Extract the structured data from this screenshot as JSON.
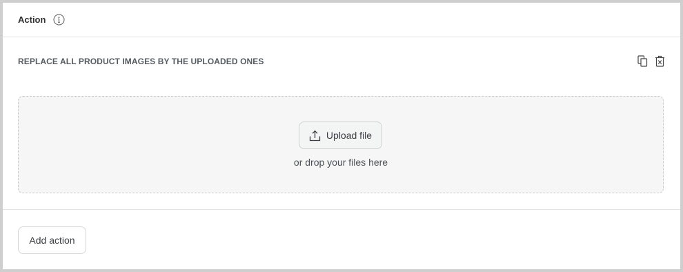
{
  "header": {
    "title": "Action",
    "info_icon": "info-icon"
  },
  "action": {
    "title": "REPLACE ALL PRODUCT IMAGES BY THE UPLOADED ONES",
    "icons": [
      "duplicate-icon",
      "delete-icon"
    ]
  },
  "dropzone": {
    "upload_label": "Upload file",
    "upload_icon": "upload-icon",
    "hint": "or drop your files here"
  },
  "footer": {
    "add_action_label": "Add action"
  }
}
